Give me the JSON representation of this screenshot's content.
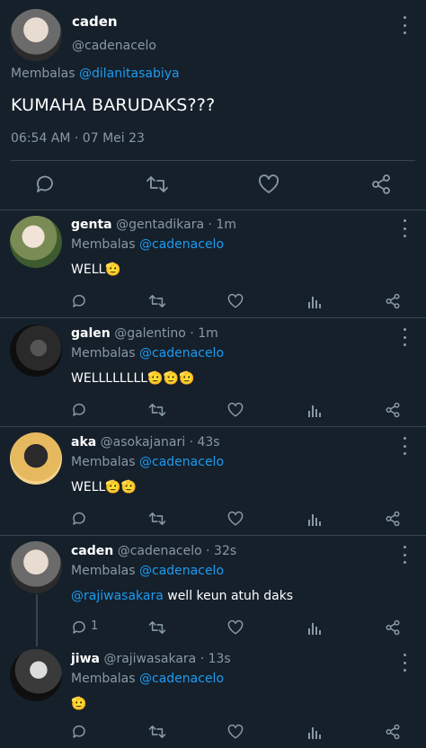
{
  "main": {
    "name": "caden",
    "handle": "@cadenacelo",
    "replying_prefix": "Membalas",
    "replying_to": "@dilanitasabiya",
    "text": "KUMAHA BARUDAKS???",
    "timestamp": "06:54 AM · 07 Mei 23"
  },
  "replies": [
    {
      "name": "genta",
      "handle": "@gentadikara",
      "time": "· 1m",
      "replying_prefix": "Membalas",
      "replying_to": "@cadenacelo",
      "text": "WELL🫡",
      "reply_count": ""
    },
    {
      "name": "galen",
      "handle": "@galentino",
      "time": "· 1m",
      "replying_prefix": "Membalas",
      "replying_to": "@cadenacelo",
      "text": "WELLLLLLLL🫡🫡🫡",
      "reply_count": ""
    },
    {
      "name": "aka",
      "handle": "@asokajanari",
      "time": "· 43s",
      "replying_prefix": "Membalas",
      "replying_to": "@cadenacelo",
      "text": "WELL🫡🫡",
      "reply_count": ""
    },
    {
      "name": "caden",
      "handle": "@cadenacelo",
      "time": "· 32s",
      "replying_prefix": "Membalas",
      "replying_to": "@cadenacelo",
      "mention": "@rajiwasakara",
      "text": " well keun atuh daks",
      "reply_count": "1"
    },
    {
      "name": "jiwa",
      "handle": "@rajiwasakara",
      "time": "· 13s",
      "replying_prefix": "Membalas",
      "replying_to": "@cadenacelo",
      "text": "🫡",
      "reply_count": ""
    }
  ],
  "colors": {
    "background": "#15202b",
    "text": "#ffffff",
    "muted": "#8899a6",
    "link": "#1d9bf0",
    "divider": "#38444d"
  },
  "icons": [
    "more-icon",
    "reply-icon",
    "retweet-icon",
    "like-icon",
    "share-icon",
    "analytics-icon"
  ]
}
